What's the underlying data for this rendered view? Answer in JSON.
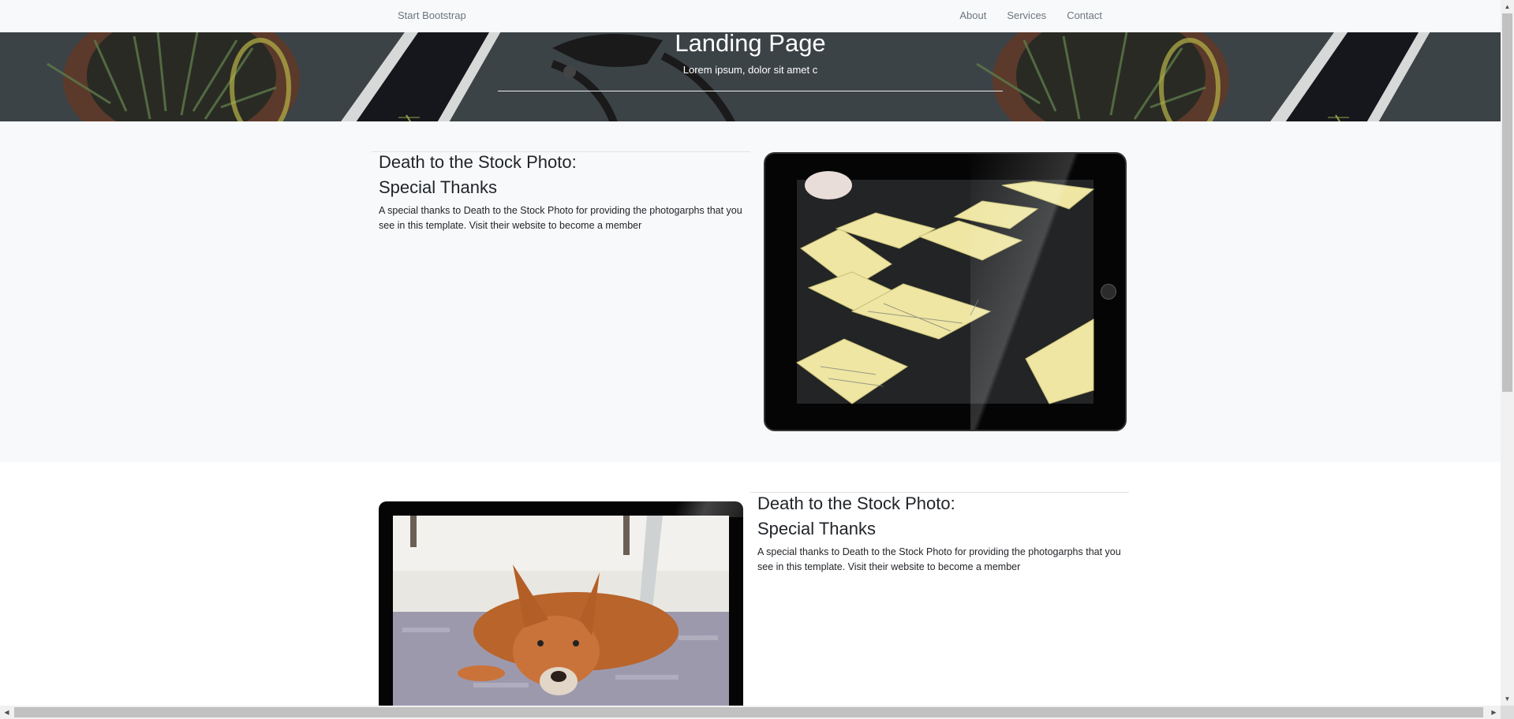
{
  "navbar": {
    "brand": "Start Bootstrap",
    "links": [
      "About",
      "Services",
      "Contact"
    ]
  },
  "header": {
    "title": "Landing Page",
    "subtitle": "Lorem ipsum, dolor sit amet c"
  },
  "showcase": [
    {
      "title_line1": "Death to the Stock Photo:",
      "title_line2": "Special Thanks",
      "text": "A special thanks to Death to the Stock Photo for providing the photogarphs that you see in this template. Visit their website to become a member"
    },
    {
      "title_line1": "Death to the Stock Photo:",
      "title_line2": "Special Thanks",
      "text": "A special thanks to Death to the Stock Photo for providing the photogarphs that you see in this template. Visit their website to become a member"
    }
  ]
}
